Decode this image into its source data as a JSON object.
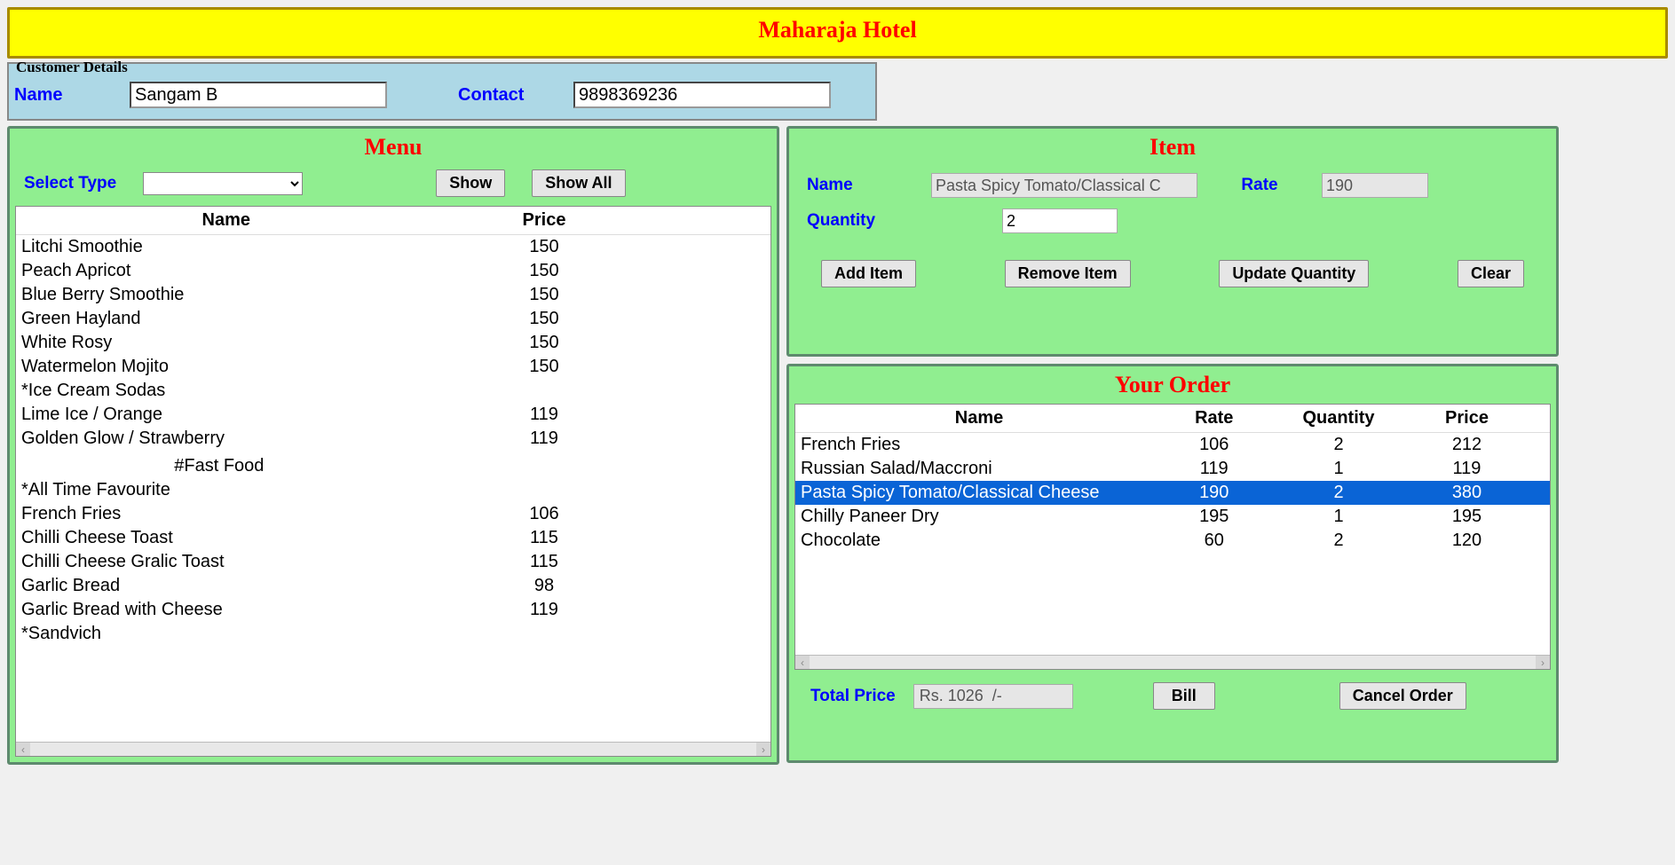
{
  "title": "Maharaja Hotel",
  "customer": {
    "legend": "Customer Details",
    "name_label": "Name",
    "name_value": "Sangam B",
    "contact_label": "Contact",
    "contact_value": "9898369236"
  },
  "menu": {
    "title": "Menu",
    "select_type_label": "Select Type",
    "select_type_value": "",
    "show_btn": "Show",
    "show_all_btn": "Show All",
    "columns": {
      "name": "Name",
      "price": "Price"
    },
    "items": [
      {
        "name": "Litchi Smoothie",
        "price": "150"
      },
      {
        "name": "Peach Apricot",
        "price": "150"
      },
      {
        "name": "Blue Berry Smoothie",
        "price": "150"
      },
      {
        "name": "Green Hayland",
        "price": "150"
      },
      {
        "name": "White Rosy",
        "price": "150"
      },
      {
        "name": "Watermelon Mojito",
        "price": "150"
      },
      {
        "name": "*Ice Cream Sodas",
        "price": ""
      },
      {
        "name": "Lime Ice / Orange",
        "price": "119"
      },
      {
        "name": "Golden Glow / Strawberry",
        "price": "119"
      },
      {
        "name": "",
        "price": ""
      },
      {
        "name": "                               #Fast Food",
        "price": ""
      },
      {
        "name": "*All Time Favourite",
        "price": ""
      },
      {
        "name": "French Fries",
        "price": "106"
      },
      {
        "name": "Chilli Cheese Toast",
        "price": "115"
      },
      {
        "name": "Chilli Cheese Gralic Toast",
        "price": "115"
      },
      {
        "name": "Garlic Bread",
        "price": "98"
      },
      {
        "name": "Garlic Bread with Cheese",
        "price": "119"
      },
      {
        "name": "*Sandvich",
        "price": ""
      }
    ]
  },
  "item": {
    "title": "Item",
    "name_label": "Name",
    "name_value": "Pasta Spicy Tomato/Classical C",
    "rate_label": "Rate",
    "rate_value": "190",
    "quantity_label": "Quantity",
    "quantity_value": "2",
    "add_btn": "Add Item",
    "remove_btn": "Remove Item",
    "update_btn": "Update Quantity",
    "clear_btn": "Clear"
  },
  "order": {
    "title": "Your Order",
    "columns": {
      "name": "Name",
      "rate": "Rate",
      "quantity": "Quantity",
      "price": "Price"
    },
    "rows": [
      {
        "name": "French Fries",
        "rate": "106",
        "quantity": "2",
        "price": "212",
        "selected": false
      },
      {
        "name": "Russian Salad/Maccroni",
        "rate": "119",
        "quantity": "1",
        "price": "119",
        "selected": false
      },
      {
        "name": "Pasta Spicy Tomato/Classical Cheese",
        "rate": "190",
        "quantity": "2",
        "price": "380",
        "selected": true
      },
      {
        "name": "Chilly Paneer Dry",
        "rate": "195",
        "quantity": "1",
        "price": "195",
        "selected": false
      },
      {
        "name": "Chocolate",
        "rate": "60",
        "quantity": "2",
        "price": "120",
        "selected": false
      }
    ],
    "total_label": "Total Price",
    "total_value": "Rs. 1026  /-",
    "bill_btn": "Bill",
    "cancel_btn": "Cancel Order"
  }
}
